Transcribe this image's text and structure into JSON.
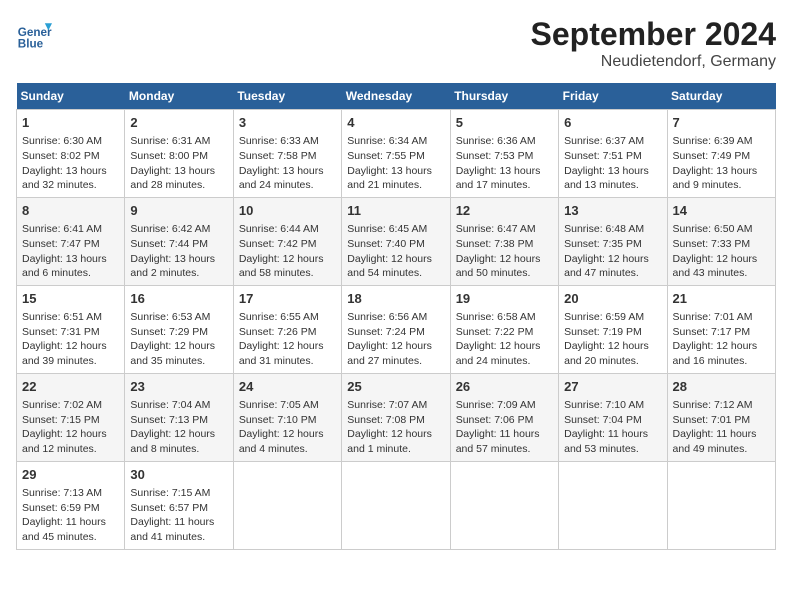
{
  "header": {
    "logo_line1": "General",
    "logo_line2": "Blue",
    "title": "September 2024",
    "subtitle": "Neudietendorf, Germany"
  },
  "weekdays": [
    "Sunday",
    "Monday",
    "Tuesday",
    "Wednesday",
    "Thursday",
    "Friday",
    "Saturday"
  ],
  "weeks": [
    [
      {
        "day": "1",
        "lines": [
          "Sunrise: 6:30 AM",
          "Sunset: 8:02 PM",
          "Daylight: 13 hours",
          "and 32 minutes."
        ]
      },
      {
        "day": "2",
        "lines": [
          "Sunrise: 6:31 AM",
          "Sunset: 8:00 PM",
          "Daylight: 13 hours",
          "and 28 minutes."
        ]
      },
      {
        "day": "3",
        "lines": [
          "Sunrise: 6:33 AM",
          "Sunset: 7:58 PM",
          "Daylight: 13 hours",
          "and 24 minutes."
        ]
      },
      {
        "day": "4",
        "lines": [
          "Sunrise: 6:34 AM",
          "Sunset: 7:55 PM",
          "Daylight: 13 hours",
          "and 21 minutes."
        ]
      },
      {
        "day": "5",
        "lines": [
          "Sunrise: 6:36 AM",
          "Sunset: 7:53 PM",
          "Daylight: 13 hours",
          "and 17 minutes."
        ]
      },
      {
        "day": "6",
        "lines": [
          "Sunrise: 6:37 AM",
          "Sunset: 7:51 PM",
          "Daylight: 13 hours",
          "and 13 minutes."
        ]
      },
      {
        "day": "7",
        "lines": [
          "Sunrise: 6:39 AM",
          "Sunset: 7:49 PM",
          "Daylight: 13 hours",
          "and 9 minutes."
        ]
      }
    ],
    [
      {
        "day": "8",
        "lines": [
          "Sunrise: 6:41 AM",
          "Sunset: 7:47 PM",
          "Daylight: 13 hours",
          "and 6 minutes."
        ]
      },
      {
        "day": "9",
        "lines": [
          "Sunrise: 6:42 AM",
          "Sunset: 7:44 PM",
          "Daylight: 13 hours",
          "and 2 minutes."
        ]
      },
      {
        "day": "10",
        "lines": [
          "Sunrise: 6:44 AM",
          "Sunset: 7:42 PM",
          "Daylight: 12 hours",
          "and 58 minutes."
        ]
      },
      {
        "day": "11",
        "lines": [
          "Sunrise: 6:45 AM",
          "Sunset: 7:40 PM",
          "Daylight: 12 hours",
          "and 54 minutes."
        ]
      },
      {
        "day": "12",
        "lines": [
          "Sunrise: 6:47 AM",
          "Sunset: 7:38 PM",
          "Daylight: 12 hours",
          "and 50 minutes."
        ]
      },
      {
        "day": "13",
        "lines": [
          "Sunrise: 6:48 AM",
          "Sunset: 7:35 PM",
          "Daylight: 12 hours",
          "and 47 minutes."
        ]
      },
      {
        "day": "14",
        "lines": [
          "Sunrise: 6:50 AM",
          "Sunset: 7:33 PM",
          "Daylight: 12 hours",
          "and 43 minutes."
        ]
      }
    ],
    [
      {
        "day": "15",
        "lines": [
          "Sunrise: 6:51 AM",
          "Sunset: 7:31 PM",
          "Daylight: 12 hours",
          "and 39 minutes."
        ]
      },
      {
        "day": "16",
        "lines": [
          "Sunrise: 6:53 AM",
          "Sunset: 7:29 PM",
          "Daylight: 12 hours",
          "and 35 minutes."
        ]
      },
      {
        "day": "17",
        "lines": [
          "Sunrise: 6:55 AM",
          "Sunset: 7:26 PM",
          "Daylight: 12 hours",
          "and 31 minutes."
        ]
      },
      {
        "day": "18",
        "lines": [
          "Sunrise: 6:56 AM",
          "Sunset: 7:24 PM",
          "Daylight: 12 hours",
          "and 27 minutes."
        ]
      },
      {
        "day": "19",
        "lines": [
          "Sunrise: 6:58 AM",
          "Sunset: 7:22 PM",
          "Daylight: 12 hours",
          "and 24 minutes."
        ]
      },
      {
        "day": "20",
        "lines": [
          "Sunrise: 6:59 AM",
          "Sunset: 7:19 PM",
          "Daylight: 12 hours",
          "and 20 minutes."
        ]
      },
      {
        "day": "21",
        "lines": [
          "Sunrise: 7:01 AM",
          "Sunset: 7:17 PM",
          "Daylight: 12 hours",
          "and 16 minutes."
        ]
      }
    ],
    [
      {
        "day": "22",
        "lines": [
          "Sunrise: 7:02 AM",
          "Sunset: 7:15 PM",
          "Daylight: 12 hours",
          "and 12 minutes."
        ]
      },
      {
        "day": "23",
        "lines": [
          "Sunrise: 7:04 AM",
          "Sunset: 7:13 PM",
          "Daylight: 12 hours",
          "and 8 minutes."
        ]
      },
      {
        "day": "24",
        "lines": [
          "Sunrise: 7:05 AM",
          "Sunset: 7:10 PM",
          "Daylight: 12 hours",
          "and 4 minutes."
        ]
      },
      {
        "day": "25",
        "lines": [
          "Sunrise: 7:07 AM",
          "Sunset: 7:08 PM",
          "Daylight: 12 hours",
          "and 1 minute."
        ]
      },
      {
        "day": "26",
        "lines": [
          "Sunrise: 7:09 AM",
          "Sunset: 7:06 PM",
          "Daylight: 11 hours",
          "and 57 minutes."
        ]
      },
      {
        "day": "27",
        "lines": [
          "Sunrise: 7:10 AM",
          "Sunset: 7:04 PM",
          "Daylight: 11 hours",
          "and 53 minutes."
        ]
      },
      {
        "day": "28",
        "lines": [
          "Sunrise: 7:12 AM",
          "Sunset: 7:01 PM",
          "Daylight: 11 hours",
          "and 49 minutes."
        ]
      }
    ],
    [
      {
        "day": "29",
        "lines": [
          "Sunrise: 7:13 AM",
          "Sunset: 6:59 PM",
          "Daylight: 11 hours",
          "and 45 minutes."
        ]
      },
      {
        "day": "30",
        "lines": [
          "Sunrise: 7:15 AM",
          "Sunset: 6:57 PM",
          "Daylight: 11 hours",
          "and 41 minutes."
        ]
      },
      null,
      null,
      null,
      null,
      null
    ]
  ]
}
